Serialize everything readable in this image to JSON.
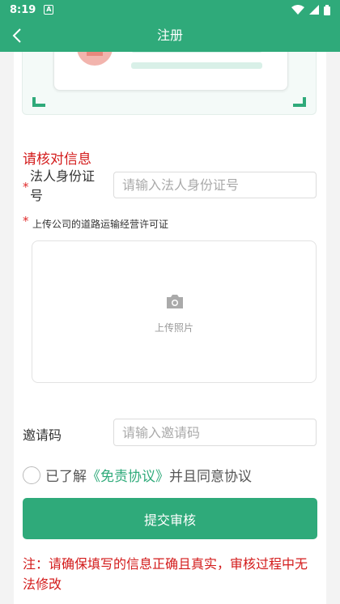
{
  "status": {
    "time": "8:19",
    "notif_glyph": "A"
  },
  "appbar": {
    "title": "注册"
  },
  "verify": {
    "title": "请核对信息",
    "id_label": "法人身份证号",
    "id_placeholder": "请输入法人身份证号",
    "required_mark": "*"
  },
  "upload": {
    "label": "上传公司的道路运输经营许可证",
    "button_text": "上传照片"
  },
  "invite": {
    "label": "邀请码",
    "placeholder": "请输入邀请码"
  },
  "agreement": {
    "prefix": "已了解",
    "link": "《免责协议》",
    "suffix": "并且同意协议"
  },
  "submit_label": "提交审核",
  "note": "注：请确保填写的信息正确且真实，审核过程中无法修改",
  "colors": {
    "accent": "#2faa7a",
    "warning": "#d31b1b"
  },
  "icons": [
    "back-arrow-icon",
    "camera-icon",
    "wifi-icon",
    "signal-icon",
    "battery-icon",
    "notification-icon"
  ]
}
